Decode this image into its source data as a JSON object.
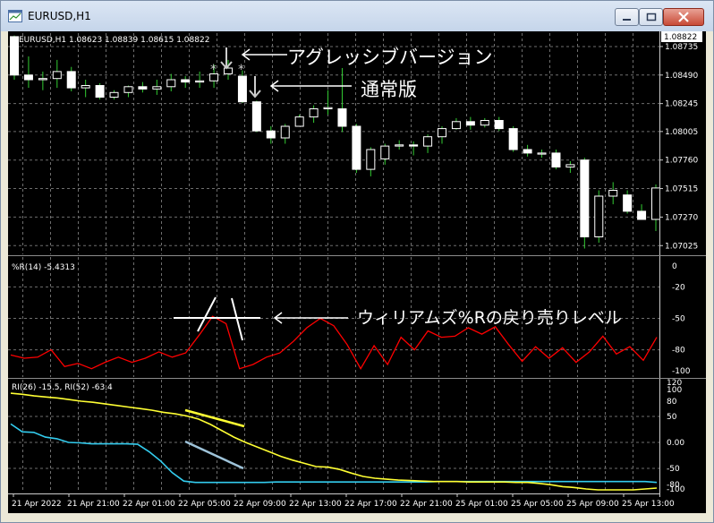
{
  "window": {
    "title": "EURUSD,H1"
  },
  "main_pane": {
    "header": "EURUSD,H1  1.08623 1.08839 1.08615 1.08822",
    "price_ticks": [
      "1.08735",
      "1.08490",
      "1.08245",
      "1.08005",
      "1.07760",
      "1.07515",
      "1.07270",
      "1.07025"
    ],
    "current_price": "1.08822",
    "annotation_aggressive": "アグレッシブバージョン",
    "annotation_normal": "通常版"
  },
  "wr_pane": {
    "header": "%R(14) -5.4313",
    "ticks": [
      "0",
      "-20",
      "-50",
      "-80",
      "-100"
    ],
    "annotation": "ウィリアムズ%Rの戻り売りレベル"
  },
  "ri_pane": {
    "header": "RI(26) -15.5, RI(52) -63.4",
    "ticks": [
      "120",
      "100",
      "80",
      "50",
      "0.00",
      "-50",
      "-80",
      "-100"
    ]
  },
  "time_axis": [
    "21 Apr 2022",
    "21 Apr 21:00",
    "22 Apr 01:00",
    "22 Apr 05:00",
    "22 Apr 09:00",
    "22 Apr 13:00",
    "22 Apr 17:00",
    "22 Apr 21:00",
    "25 Apr 01:00",
    "25 Apr 05:00",
    "25 Apr 09:00",
    "25 Apr 13:00"
  ],
  "colors": {
    "bull": "#ffffff",
    "bear": "#ffffff",
    "wick": "#33cc33",
    "wr_line": "#ff0000",
    "ri_fast": "#ffff33",
    "ri_slow": "#33ccee"
  },
  "chart_data": [
    {
      "type": "candlestick",
      "ylim": [
        1.0695,
        1.0885
      ],
      "series": [
        {
          "ohlc": [
            [
              1.0882,
              1.0883,
              1.0845,
              1.0849
            ],
            [
              1.0849,
              1.0865,
              1.0838,
              1.0845
            ],
            [
              1.0845,
              1.0852,
              1.0836,
              1.0846
            ],
            [
              1.0846,
              1.0862,
              1.0838,
              1.0852
            ],
            [
              1.0852,
              1.0856,
              1.0835,
              1.0838
            ],
            [
              1.0838,
              1.0845,
              1.083,
              1.084
            ],
            [
              1.084,
              1.0842,
              1.0828,
              1.083
            ],
            [
              1.083,
              1.0836,
              1.0828,
              1.0834
            ],
            [
              1.0834,
              1.084,
              1.083,
              1.0839
            ],
            [
              1.0839,
              1.0843,
              1.0834,
              1.0837
            ],
            [
              1.0837,
              1.0845,
              1.0832,
              1.0839
            ],
            [
              1.0839,
              1.085,
              1.0835,
              1.0845
            ],
            [
              1.0845,
              1.0848,
              1.0838,
              1.0843
            ],
            [
              1.0843,
              1.0852,
              1.0838,
              1.0844
            ],
            [
              1.0844,
              1.0858,
              1.0838,
              1.085
            ],
            [
              1.085,
              1.0862,
              1.0845,
              1.0855
            ],
            [
              1.0848,
              1.0853,
              1.0825,
              1.0826
            ],
            [
              1.0826,
              1.0827,
              1.08,
              1.0801
            ],
            [
              1.0801,
              1.0805,
              1.079,
              1.0795
            ],
            [
              1.0795,
              1.0807,
              1.079,
              1.0805
            ],
            [
              1.0805,
              1.0815,
              1.0805,
              1.0813
            ],
            [
              1.0813,
              1.0823,
              1.0808,
              1.082
            ],
            [
              1.082,
              1.0836,
              1.0815,
              1.0821
            ],
            [
              1.082,
              1.0855,
              1.08,
              1.0805
            ],
            [
              1.0805,
              1.0807,
              1.0765,
              1.0768
            ],
            [
              1.0768,
              1.0787,
              1.0762,
              1.0785
            ],
            [
              1.0777,
              1.079,
              1.0772,
              1.0788
            ],
            [
              1.0788,
              1.0793,
              1.0785,
              1.0789
            ],
            [
              1.0789,
              1.0792,
              1.078,
              1.0788
            ],
            [
              1.0788,
              1.0798,
              1.0782,
              1.0796
            ],
            [
              1.0796,
              1.0805,
              1.079,
              1.0803
            ],
            [
              1.0803,
              1.0812,
              1.0802,
              1.0809
            ],
            [
              1.0809,
              1.0813,
              1.0802,
              1.0806
            ],
            [
              1.0806,
              1.0812,
              1.0804,
              1.081
            ],
            [
              1.081,
              1.0813,
              1.0801,
              1.0803
            ],
            [
              1.0803,
              1.0805,
              1.0783,
              1.0785
            ],
            [
              1.0785,
              1.0789,
              1.0779,
              1.0782
            ],
            [
              1.0782,
              1.0785,
              1.0778,
              1.0782
            ],
            [
              1.0782,
              1.0785,
              1.0768,
              1.077
            ],
            [
              1.077,
              1.0775,
              1.0765,
              1.0772
            ],
            [
              1.0776,
              1.0778,
              1.07,
              1.071
            ],
            [
              1.071,
              1.075,
              1.0705,
              1.0745
            ],
            [
              1.0745,
              1.0757,
              1.0738,
              1.075
            ],
            [
              1.0746,
              1.075,
              1.073,
              1.0732
            ],
            [
              1.0732,
              1.0738,
              1.0725,
              1.0725
            ],
            [
              1.0725,
              1.0755,
              1.0715,
              1.0752
            ]
          ]
        }
      ]
    },
    {
      "type": "line",
      "ylim": [
        -100,
        0
      ],
      "series": [
        {
          "name": "%R(14)",
          "values": [
            -85,
            -88,
            -87,
            -80,
            -96,
            -93,
            -98,
            -92,
            -87,
            -92,
            -88,
            -82,
            -87,
            -83,
            -66,
            -48,
            -55,
            -98,
            -94,
            -87,
            -83,
            -72,
            -59,
            -50,
            -57,
            -75,
            -98,
            -76,
            -94,
            -68,
            -80,
            -62,
            -68,
            -67,
            -59,
            -65,
            -58,
            -75,
            -91,
            -77,
            -88,
            -78,
            -92,
            -82,
            -67,
            -84,
            -77,
            -90,
            -68
          ]
        }
      ]
    },
    {
      "type": "line",
      "ylim": [
        -110,
        120
      ],
      "series": [
        {
          "name": "RI(26)",
          "values": [
            93,
            91,
            88,
            86,
            84,
            81,
            78,
            76,
            73,
            70,
            67,
            64,
            61,
            57,
            54,
            50,
            44,
            34,
            22,
            10,
            0,
            -10,
            -20,
            -30,
            -38,
            -45,
            -52,
            -53,
            -58,
            -66,
            -73,
            -77,
            -79,
            -81,
            -82,
            -83,
            -84,
            -84,
            -84,
            -85,
            -85,
            -85,
            -85,
            -86,
            -86,
            -88,
            -91,
            -95,
            -97,
            -100,
            -102,
            -102,
            -102,
            -102,
            -100,
            -98
          ]
        },
        {
          "name": "RI(52)",
          "values": [
            35,
            20,
            19,
            10,
            7,
            0,
            -1,
            -3,
            -3,
            -3,
            -3,
            -4,
            -20,
            -40,
            -65,
            -83,
            -86,
            -86,
            -86,
            -86,
            -86,
            -86,
            -86,
            -85,
            -85,
            -85,
            -85,
            -85,
            -85,
            -85,
            -85,
            -85,
            -85,
            -85,
            -85,
            -85,
            -85,
            -84,
            -84,
            -84,
            -84,
            -84,
            -84,
            -84,
            -84,
            -84,
            -84,
            -84,
            -84,
            -84,
            -84,
            -84,
            -84,
            -84,
            -84,
            -84,
            -86
          ]
        }
      ]
    }
  ]
}
